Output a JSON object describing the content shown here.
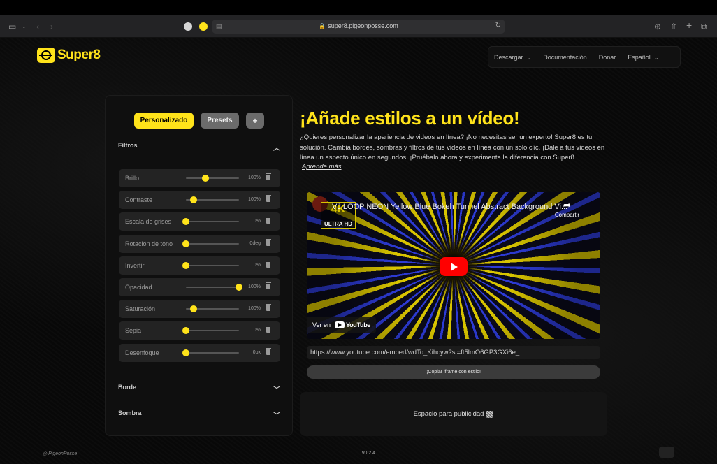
{
  "browser": {
    "url": "super8.pigeonposse.com",
    "lock_icon": "lock-icon",
    "reload_icon": "reload-icon"
  },
  "header": {
    "logo_text": "Super8",
    "nav": [
      {
        "label": "Descargar",
        "has_dropdown": true
      },
      {
        "label": "Documentación",
        "has_dropdown": false
      },
      {
        "label": "Donar",
        "has_dropdown": false
      },
      {
        "label": "Español",
        "has_dropdown": true
      }
    ]
  },
  "panel": {
    "tabs": {
      "custom": "Personalizado",
      "presets": "Presets",
      "add": "+"
    },
    "filters_title": "Filtros",
    "filters": [
      {
        "label": "Brillo",
        "value": "100%",
        "slider_fraction": 0.37
      },
      {
        "label": "Contraste",
        "value": "100%",
        "slider_fraction": 0.15
      },
      {
        "label": "Escala de grises",
        "value": "0%",
        "slider_fraction": 0.0
      },
      {
        "label": "Rotación de tono",
        "value": "0deg",
        "slider_fraction": 0.0
      },
      {
        "label": "Invertir",
        "value": "0%",
        "slider_fraction": 0.0
      },
      {
        "label": "Opacidad",
        "value": "100%",
        "slider_fraction": 1.0
      },
      {
        "label": "Saturación",
        "value": "100%",
        "slider_fraction": 0.15
      },
      {
        "label": "Sepia",
        "value": "0%",
        "slider_fraction": 0.0
      },
      {
        "label": "Desenfoque",
        "value": "0px",
        "slider_fraction": 0.0
      }
    ],
    "border_title": "Borde",
    "shadow_title": "Sombra"
  },
  "main": {
    "title": "¡Añade estilos a un vídeo!",
    "description": "¿Quieres personalizar la apariencia de videos en línea? ¡No necesitas ser un experto! Super8 es tu solución. Cambia bordes, sombras y filtros de tus videos en línea con un solo clic. ¡Dale a tus videos en línea un aspecto único en segundos! ¡Pruébalo ahora y experimenta la diferencia con Super8.",
    "learn_more": "Aprende más",
    "video": {
      "title": "VJ LOOP NEON Yellow Blue Bokeh Tunnel Abstract Background Vi...",
      "badge_4k": "4K",
      "badge_hd": "ULTRA HD",
      "share_label": "Compartir",
      "watch_on": "Ver en",
      "youtube": "YouTube"
    },
    "embed_url": "https://www.youtube.com/embed/wdTo_Kihcyw?si=ft5lmO6GP3GXi6e_",
    "copy_button": "¡Copiar iframe con estilo!",
    "ad_text": "Espacio para publicidad"
  },
  "footer": {
    "credit": "PigeonPosse",
    "version": "v0.2.4",
    "more": "···"
  },
  "colors": {
    "accent": "#ffe31a",
    "background": "#090909",
    "panel": "#0f0f0f"
  }
}
